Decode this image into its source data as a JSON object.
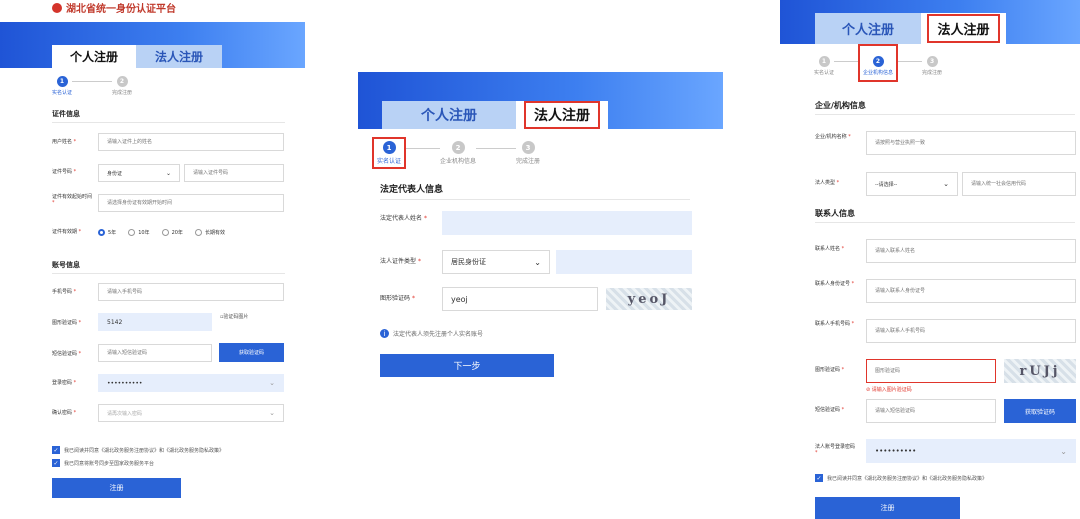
{
  "left": {
    "logo_text": "湖北省统一身份认证平台",
    "tabs": {
      "personal": "个人注册",
      "legal": "法人注册"
    },
    "steps": [
      {
        "num": "1",
        "label": "实名认证"
      },
      {
        "num": "2",
        "label": "完成注册"
      }
    ],
    "sections": {
      "cert": "证件信息",
      "account": "账号信息"
    },
    "fields": {
      "name": {
        "label": "用户姓名",
        "placeholder": "请输入证件上的姓名"
      },
      "id_no": {
        "label": "证件号码",
        "select": "身份证",
        "placeholder": "请输入证件号码"
      },
      "valid_start": {
        "label": "证件有效起始时间",
        "placeholder": "请选择身份证有效期开始时间"
      },
      "valid_period": {
        "label": "证件有效期",
        "options": [
          "5年",
          "10年",
          "20年",
          "长期有效"
        ]
      },
      "phone": {
        "label": "手机号码",
        "placeholder": "请输入手机号码"
      },
      "captcha": {
        "label": "图形验证码",
        "value": "5142",
        "img_alt": "验证码图片"
      },
      "sms": {
        "label": "短信验证码",
        "placeholder": "请输入短信验证码",
        "button": "获取验证码"
      },
      "password": {
        "label": "登录密码",
        "value": "••••••••••"
      },
      "confirm": {
        "label": "确认密码",
        "placeholder": "请再次输入密码"
      }
    },
    "agree1": "我已阅读并同意《湖北政务服务注册协议》和《湖北政务服务隐私政策》",
    "agree2": "我已同意将账号同步至国家政务服务平台",
    "submit": "注册"
  },
  "middle": {
    "tabs": {
      "personal": "个人注册",
      "legal": "法人注册"
    },
    "steps": [
      {
        "num": "1",
        "label": "实名认证"
      },
      {
        "num": "2",
        "label": "企业机构信息"
      },
      {
        "num": "3",
        "label": "完成注册"
      }
    ],
    "section": "法定代表人信息",
    "fields": {
      "rep_name": {
        "label": "法定代表人姓名",
        "value": ""
      },
      "rep_cert": {
        "label": "法人证件类型",
        "select": "居民身份证",
        "value": ""
      },
      "captcha": {
        "label": "图形验证码",
        "value": "yeoj",
        "captcha_text": "yeoJ"
      }
    },
    "note": "法定代表人须先注册个人实名账号",
    "next": "下一步"
  },
  "right": {
    "tabs": {
      "personal": "个人注册",
      "legal": "法人注册"
    },
    "steps": [
      {
        "num": "1",
        "label": "实名认证"
      },
      {
        "num": "2",
        "label": "企业机构信息"
      },
      {
        "num": "3",
        "label": "完成注册"
      }
    ],
    "sections": {
      "org": "企业/机构信息",
      "contact": "联系人信息"
    },
    "fields": {
      "org_name": {
        "label": "企业/机构名称",
        "placeholder": "请按照与营业执照一致"
      },
      "legal_type": {
        "label": "法人类型",
        "select": "--请选择--",
        "placeholder": "请输入统一社会信用代码"
      },
      "contact_name": {
        "label": "联系人姓名",
        "placeholder": "请输入联系人姓名"
      },
      "contact_id": {
        "label": "联系人身份证号",
        "placeholder": "请输入联系人身份证号"
      },
      "contact_phone": {
        "label": "联系人手机号码",
        "placeholder": "请输入联系人手机号码"
      },
      "captcha": {
        "label": "图形验证码",
        "placeholder": "图形验证码",
        "error": "请输入图片验证码",
        "captcha_text": "rUJj"
      },
      "sms": {
        "label": "短信验证码",
        "placeholder": "请输入短信验证码",
        "button": "获取验证码"
      },
      "password": {
        "label": "法人账号登录密码",
        "value": "••••••••••"
      }
    },
    "agree": "我已阅读并同意《湖北政务服务注册协议》和《湖北政务服务隐私政策》",
    "submit": "注册"
  }
}
